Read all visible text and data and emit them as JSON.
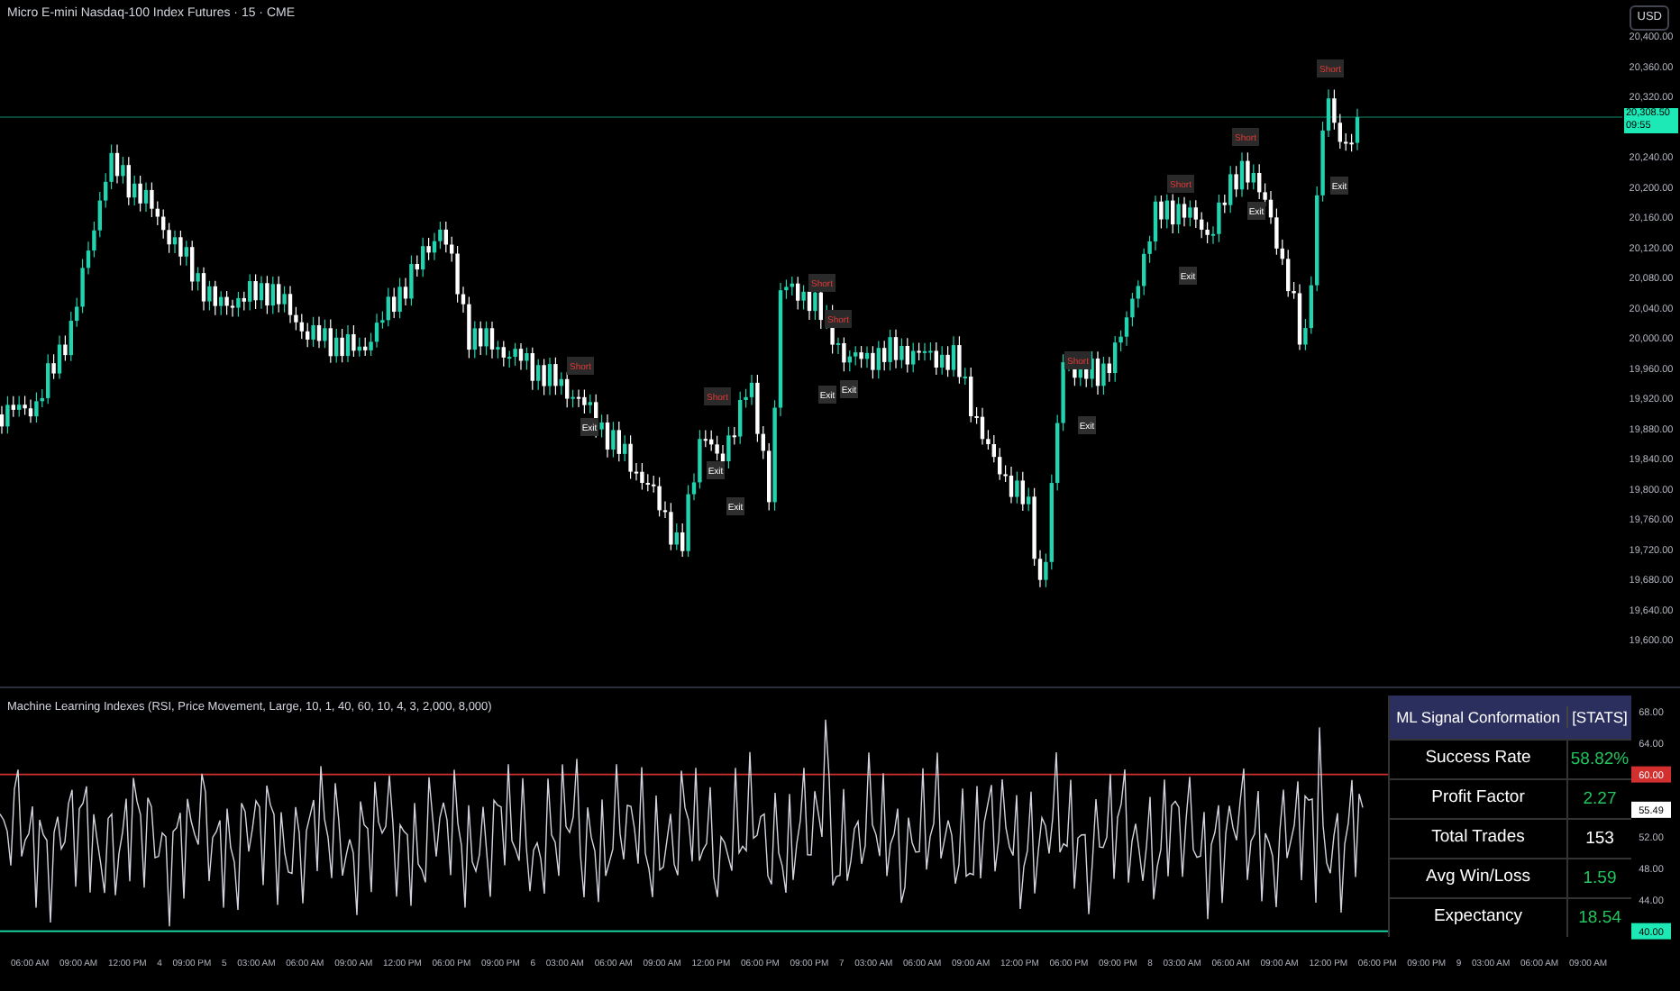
{
  "symbol_title": "Micro E-mini Nasdaq-100 Index Futures · 15 · CME",
  "currency_button": "USD",
  "price_chart": {
    "axis_labels": [
      "20,400.00",
      "20,360.00",
      "20,320.00",
      "20,240.00",
      "20,200.00",
      "20,160.00",
      "20,120.00",
      "20,080.00",
      "20,040.00",
      "20,000.00",
      "19,960.00",
      "19,920.00",
      "19,880.00",
      "19,840.00",
      "19,800.00",
      "19,760.00",
      "19,720.00",
      "19,680.00",
      "19,640.00",
      "19,600.00"
    ],
    "signal_labels": [
      {
        "kind": "short",
        "text": "Short"
      },
      {
        "kind": "short",
        "text": "Short"
      },
      {
        "kind": "short",
        "text": "Short"
      },
      {
        "kind": "short",
        "text": "Short"
      },
      {
        "kind": "short",
        "text": "Short"
      },
      {
        "kind": "short",
        "text": "Short"
      },
      {
        "kind": "short",
        "text": "Short"
      },
      {
        "kind": "short",
        "text": "Short"
      },
      {
        "kind": "exit",
        "text": "Exit"
      },
      {
        "kind": "exit",
        "text": "Exit"
      },
      {
        "kind": "exit",
        "text": "Exit"
      },
      {
        "kind": "exit",
        "text": "Exit"
      },
      {
        "kind": "exit",
        "text": "Exit"
      },
      {
        "kind": "exit",
        "text": "Exit"
      },
      {
        "kind": "exit",
        "text": "Exit"
      },
      {
        "kind": "exit",
        "text": "Exit"
      },
      {
        "kind": "exit",
        "text": "Exit"
      }
    ],
    "last_price": {
      "price": "20,308.50",
      "countdown": "09:55"
    }
  },
  "indicator": {
    "title": "Machine Learning Indexes (RSI, Price Movement, Large, 10, 1, 40, 60, 10, 4, 3, 2,000, 8,000)",
    "axis_labels": [
      "68.00",
      "64.00",
      "52.00",
      "48.00",
      "44.00"
    ],
    "upper_band": "60.00",
    "lower_band": "40.00",
    "current": "55.49"
  },
  "stats_table": {
    "header": [
      "ML Signal Conformation",
      "[STATS]"
    ],
    "rows": [
      {
        "label": "Success Rate",
        "value": "58.82%",
        "highlight": true
      },
      {
        "label": "Profit Factor",
        "value": "2.27",
        "highlight": true
      },
      {
        "label": "Total Trades",
        "value": "153",
        "highlight": false
      },
      {
        "label": "Avg Win/Loss",
        "value": "1.59",
        "highlight": true
      },
      {
        "label": "Expectancy",
        "value": "18.54",
        "highlight": true
      }
    ]
  },
  "time_axis": [
    "06:00 AM",
    "09:00 AM",
    "12:00 PM",
    "4",
    "09:00 PM",
    "5",
    "03:00 AM",
    "06:00 AM",
    "09:00 AM",
    "12:00 PM",
    "06:00 PM",
    "09:00 PM",
    "6",
    "03:00 AM",
    "06:00 AM",
    "09:00 AM",
    "12:00 PM",
    "06:00 PM",
    "09:00 PM",
    "7",
    "03:00 AM",
    "06:00 AM",
    "09:00 AM",
    "12:00 PM",
    "06:00 PM",
    "09:00 PM",
    "8",
    "03:00 AM",
    "06:00 AM",
    "09:00 AM",
    "12:00 PM",
    "06:00 PM",
    "09:00 PM",
    "9",
    "03:00 AM",
    "06:00 AM",
    "09:00 AM"
  ]
}
